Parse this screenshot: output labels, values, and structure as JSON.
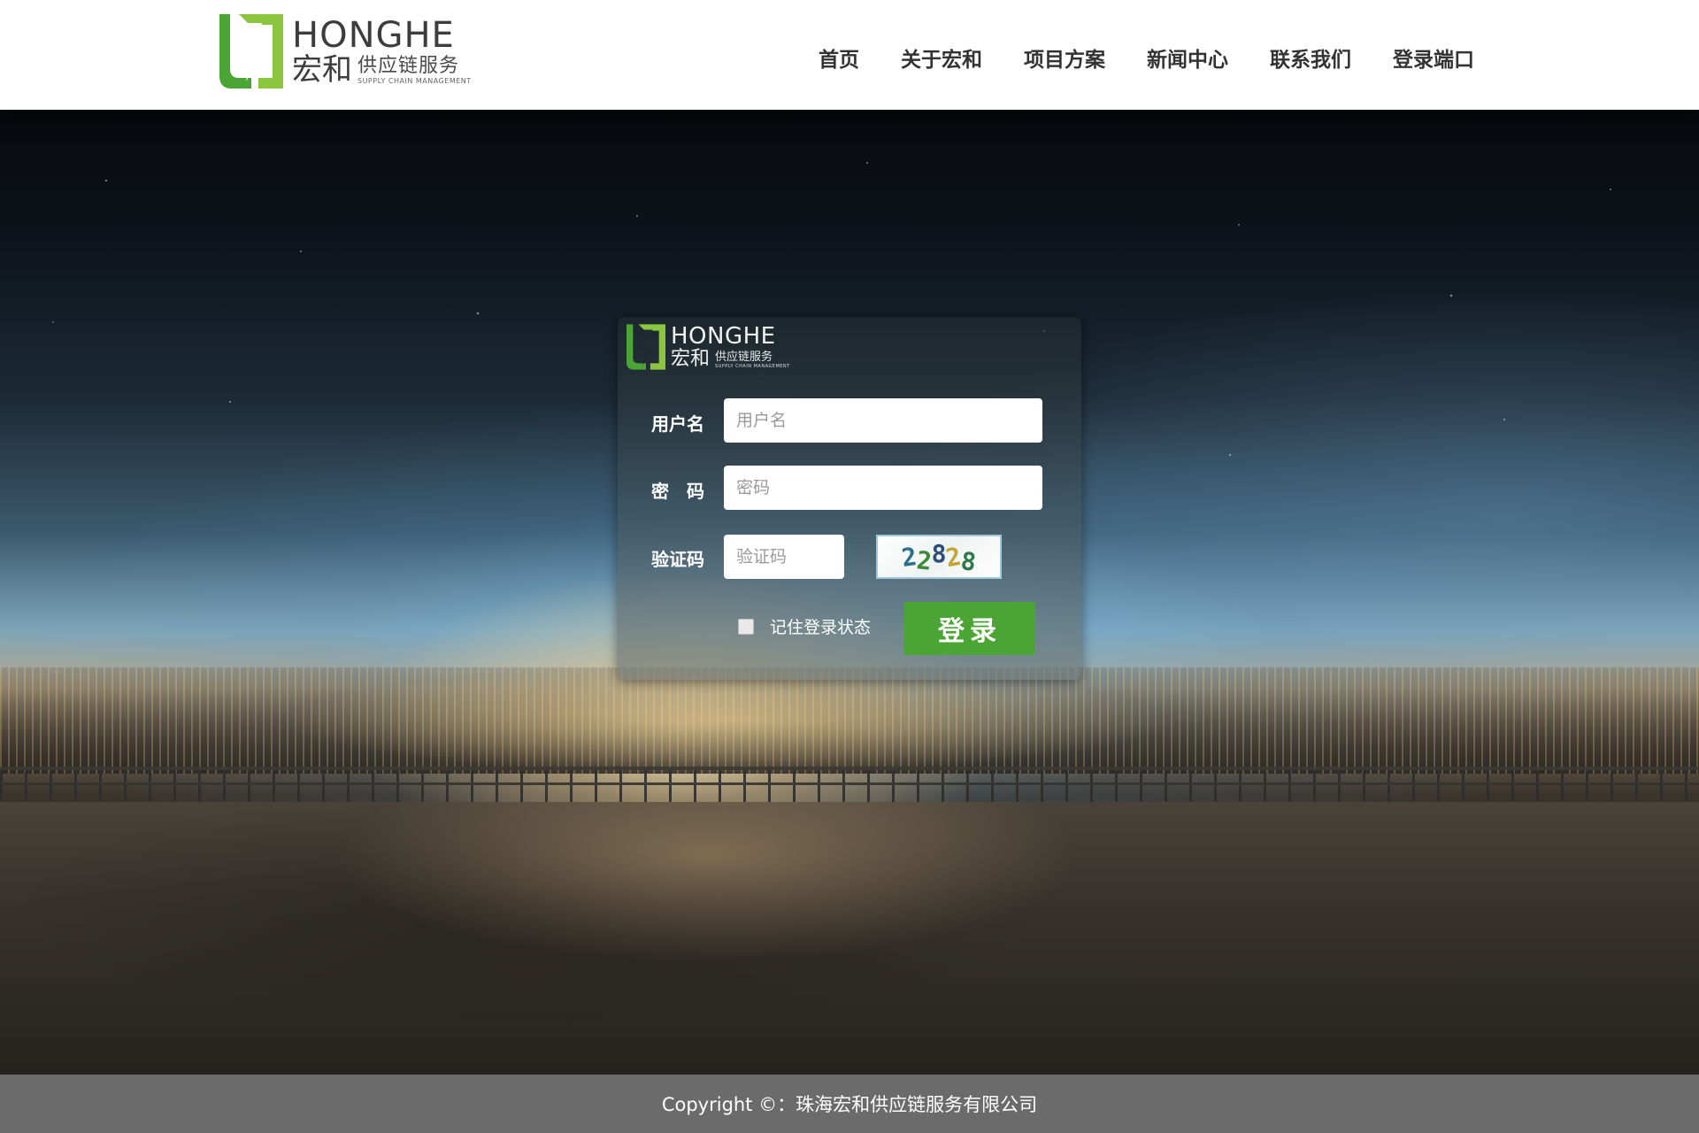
{
  "brand": {
    "name_en": "HONGHE",
    "name_cn": "宏和",
    "tagline_cn": "供应链服务",
    "tagline_en": "SUPPLY CHAIN MANAGEMENT",
    "colors": {
      "green": "#4ba535",
      "light_green": "#8cc63f"
    }
  },
  "nav": {
    "items": [
      {
        "label": "首页"
      },
      {
        "label": "关于宏和"
      },
      {
        "label": "项目方案"
      },
      {
        "label": "新闻中心"
      },
      {
        "label": "联系我们"
      },
      {
        "label": "登录端口"
      }
    ]
  },
  "login": {
    "username": {
      "label": "用户名",
      "placeholder": "用户名",
      "value": ""
    },
    "password": {
      "label": "密　码",
      "placeholder": "密码",
      "value": ""
    },
    "captcha": {
      "label": "验证码",
      "placeholder": "验证码",
      "value": "",
      "image_text": [
        "2",
        "2",
        "8",
        "2",
        "8"
      ]
    },
    "remember_label": "记住登录状态",
    "remember_checked": false,
    "submit_label": "登录"
  },
  "footer": {
    "copyright": "Copyright ©：珠海宏和供应链服务有限公司"
  }
}
